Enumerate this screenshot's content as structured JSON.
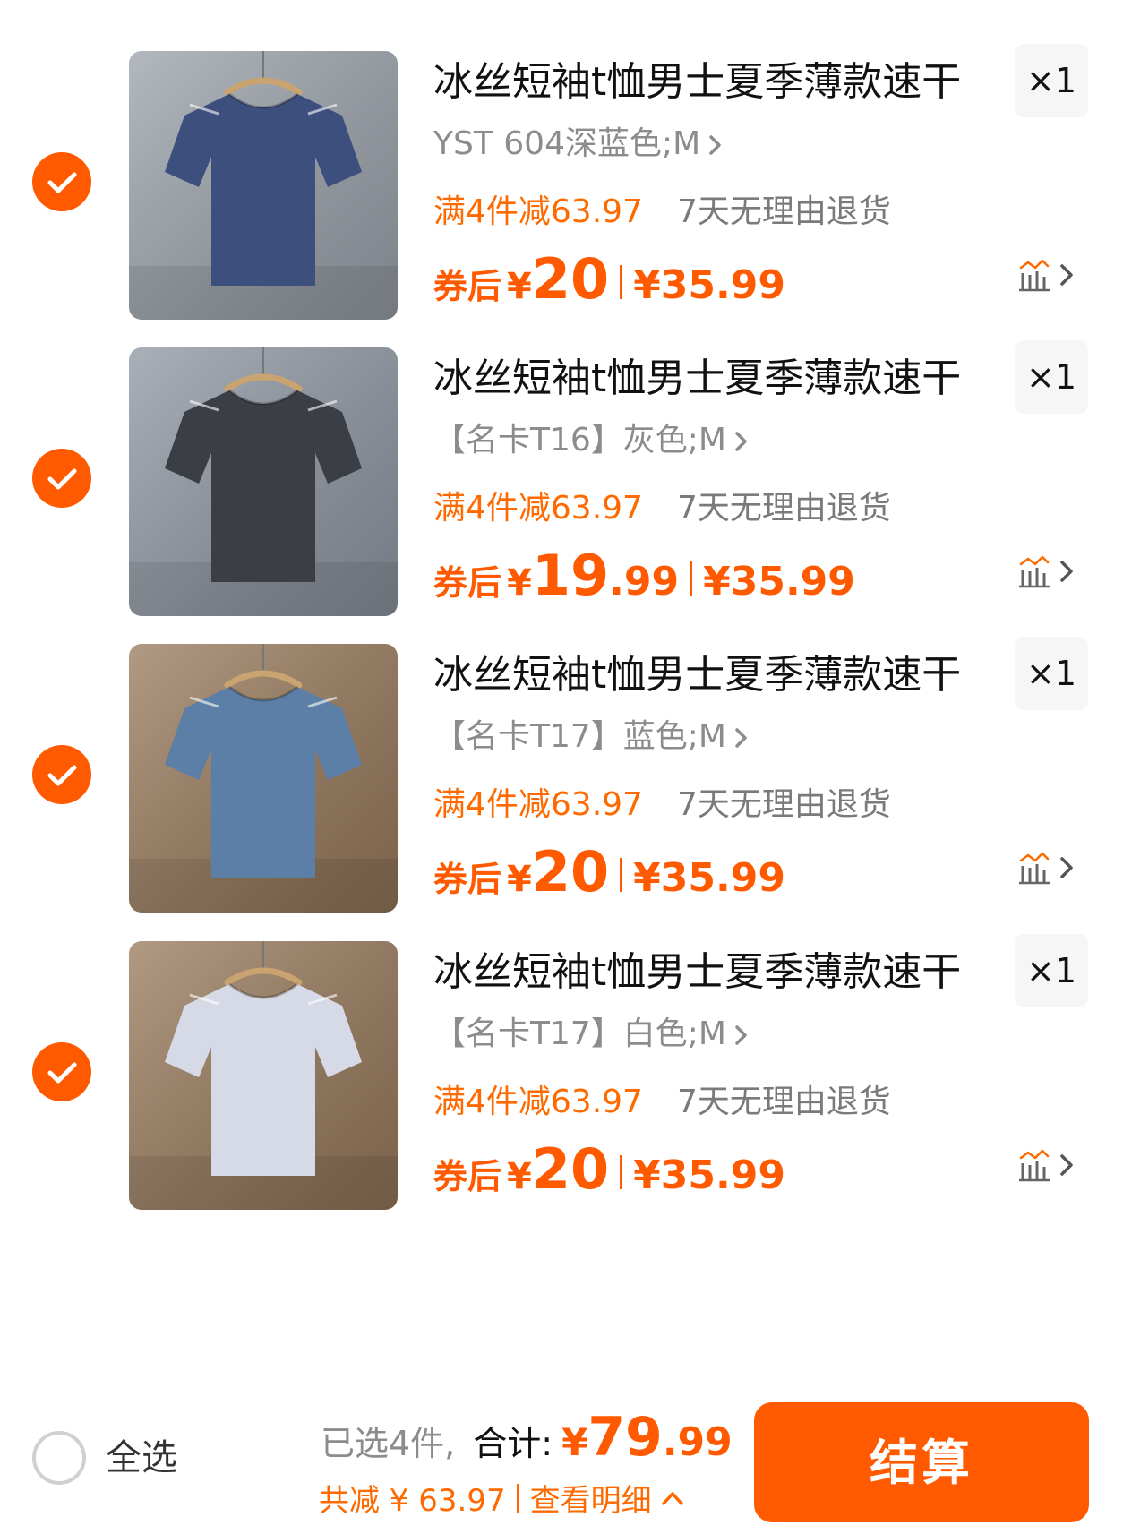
{
  "colors": {
    "accent": "#ff5a00",
    "promo": "#ff6a00",
    "muted": "#8c8c8c",
    "qty_bg": "#f6f6f6"
  },
  "items": [
    {
      "title": "冰丝短袖t恤男士夏季薄款速干",
      "quantity": "×1",
      "sku": "YST  604深蓝色;M",
      "promo_discount": "满4件减63.97",
      "promo_return": "7天无理由退货",
      "price_label": "券后",
      "currency": "¥",
      "price_int": "20",
      "price_dec": "",
      "original_price": "¥35.99",
      "shirt_color": "#3d4f7c",
      "bg_color": "#9aa1aa",
      "icons": [
        "check-icon",
        "price-trend-icon",
        "chevron-right-icon"
      ]
    },
    {
      "title": "冰丝短袖t恤男士夏季薄款速干",
      "quantity": "×1",
      "sku": "【名卡T16】灰色;M",
      "promo_discount": "满4件减63.97",
      "promo_return": "7天无理由退货",
      "price_label": "券后",
      "currency": "¥",
      "price_int": "19",
      "price_dec": ".99",
      "original_price": "¥35.99",
      "shirt_color": "#3b3f45",
      "bg_color": "#8e96a1",
      "icons": [
        "check-icon",
        "price-trend-icon",
        "chevron-right-icon"
      ]
    },
    {
      "title": "冰丝短袖t恤男士夏季薄款速干",
      "quantity": "×1",
      "sku": "【名卡T17】蓝色;M",
      "promo_discount": "满4件减63.97",
      "promo_return": "7天无理由退货",
      "price_label": "券后",
      "currency": "¥",
      "price_int": "20",
      "price_dec": "",
      "original_price": "¥35.99",
      "shirt_color": "#5b7fa6",
      "bg_color": "#97785a",
      "icons": [
        "check-icon",
        "price-trend-icon",
        "chevron-right-icon"
      ]
    },
    {
      "title": "冰丝短袖t恤男士夏季薄款速干",
      "quantity": "×1",
      "sku": "【名卡T17】白色;M",
      "promo_discount": "满4件减63.97",
      "promo_return": "7天无理由退货",
      "price_label": "券后",
      "currency": "¥",
      "price_int": "20",
      "price_dec": "",
      "original_price": "¥35.99",
      "shirt_color": "#d6dae6",
      "bg_color": "#97785a",
      "icons": [
        "check-icon",
        "price-trend-icon",
        "chevron-right-icon"
      ]
    }
  ],
  "bottom_bar": {
    "select_all_label": "全选",
    "selected_count": "已选4件,",
    "total_label": "合计:",
    "total_currency": "¥",
    "total_int": "79",
    "total_dec": ".99",
    "discount_text": "共减 ¥ 63.97",
    "detail_link": "查看明细",
    "checkout_label": "结算"
  }
}
